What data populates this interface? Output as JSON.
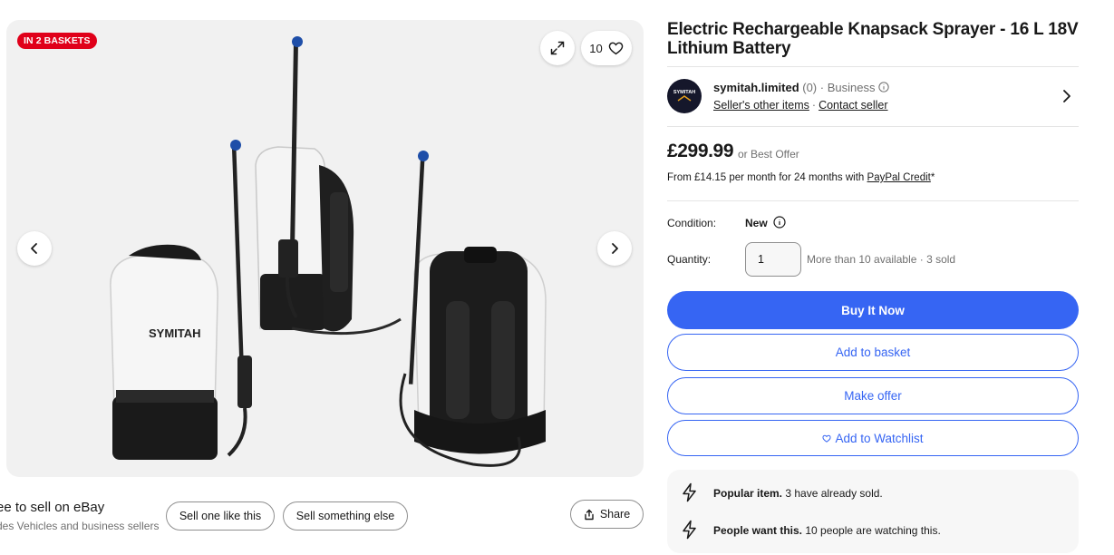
{
  "gallery": {
    "badge": "IN 2 BASKETS",
    "watch_count": "10",
    "product_brand_text": "SYMITAH"
  },
  "listing": {
    "title": "Electric Rechargeable Knapsack Sprayer - 16 L 18V Lithium Battery"
  },
  "seller": {
    "name": "symitah.limited",
    "meta": " (0) · Business",
    "other_items_label": "Seller's other items",
    "separator": "·",
    "contact_label": "Contact seller",
    "logo_text": "SYMITAH"
  },
  "pricing": {
    "price": "£299.99",
    "best_offer": "or Best Offer",
    "finance_prefix": "From £14.15 per month for 24 months with ",
    "finance_link": "PayPal Credit",
    "finance_suffix": "*"
  },
  "condition": {
    "label": "Condition:",
    "value": "New"
  },
  "quantity": {
    "label": "Quantity:",
    "value": "1",
    "availability": "More than 10 available · 3 sold"
  },
  "actions": {
    "buy_now": "Buy It Now",
    "add_to_basket": "Add to basket",
    "make_offer": "Make offer",
    "add_to_watchlist": "Add to Watchlist"
  },
  "signals": [
    {
      "bold": "Popular item.",
      "text": " 3 have already sold."
    },
    {
      "bold": "People want this.",
      "text": " 10 people are watching this."
    }
  ],
  "footer": {
    "sell_title": "ee to sell on eBay",
    "sell_subtitle": "des Vehicles and business sellers",
    "sell_one_like_this": "Sell one like this",
    "sell_something_else": "Sell something else",
    "share": "Share"
  },
  "colors": {
    "accent_blue": "#3665f3",
    "badge_red": "#e0001a",
    "text_primary": "#191919",
    "text_secondary": "#707070"
  }
}
